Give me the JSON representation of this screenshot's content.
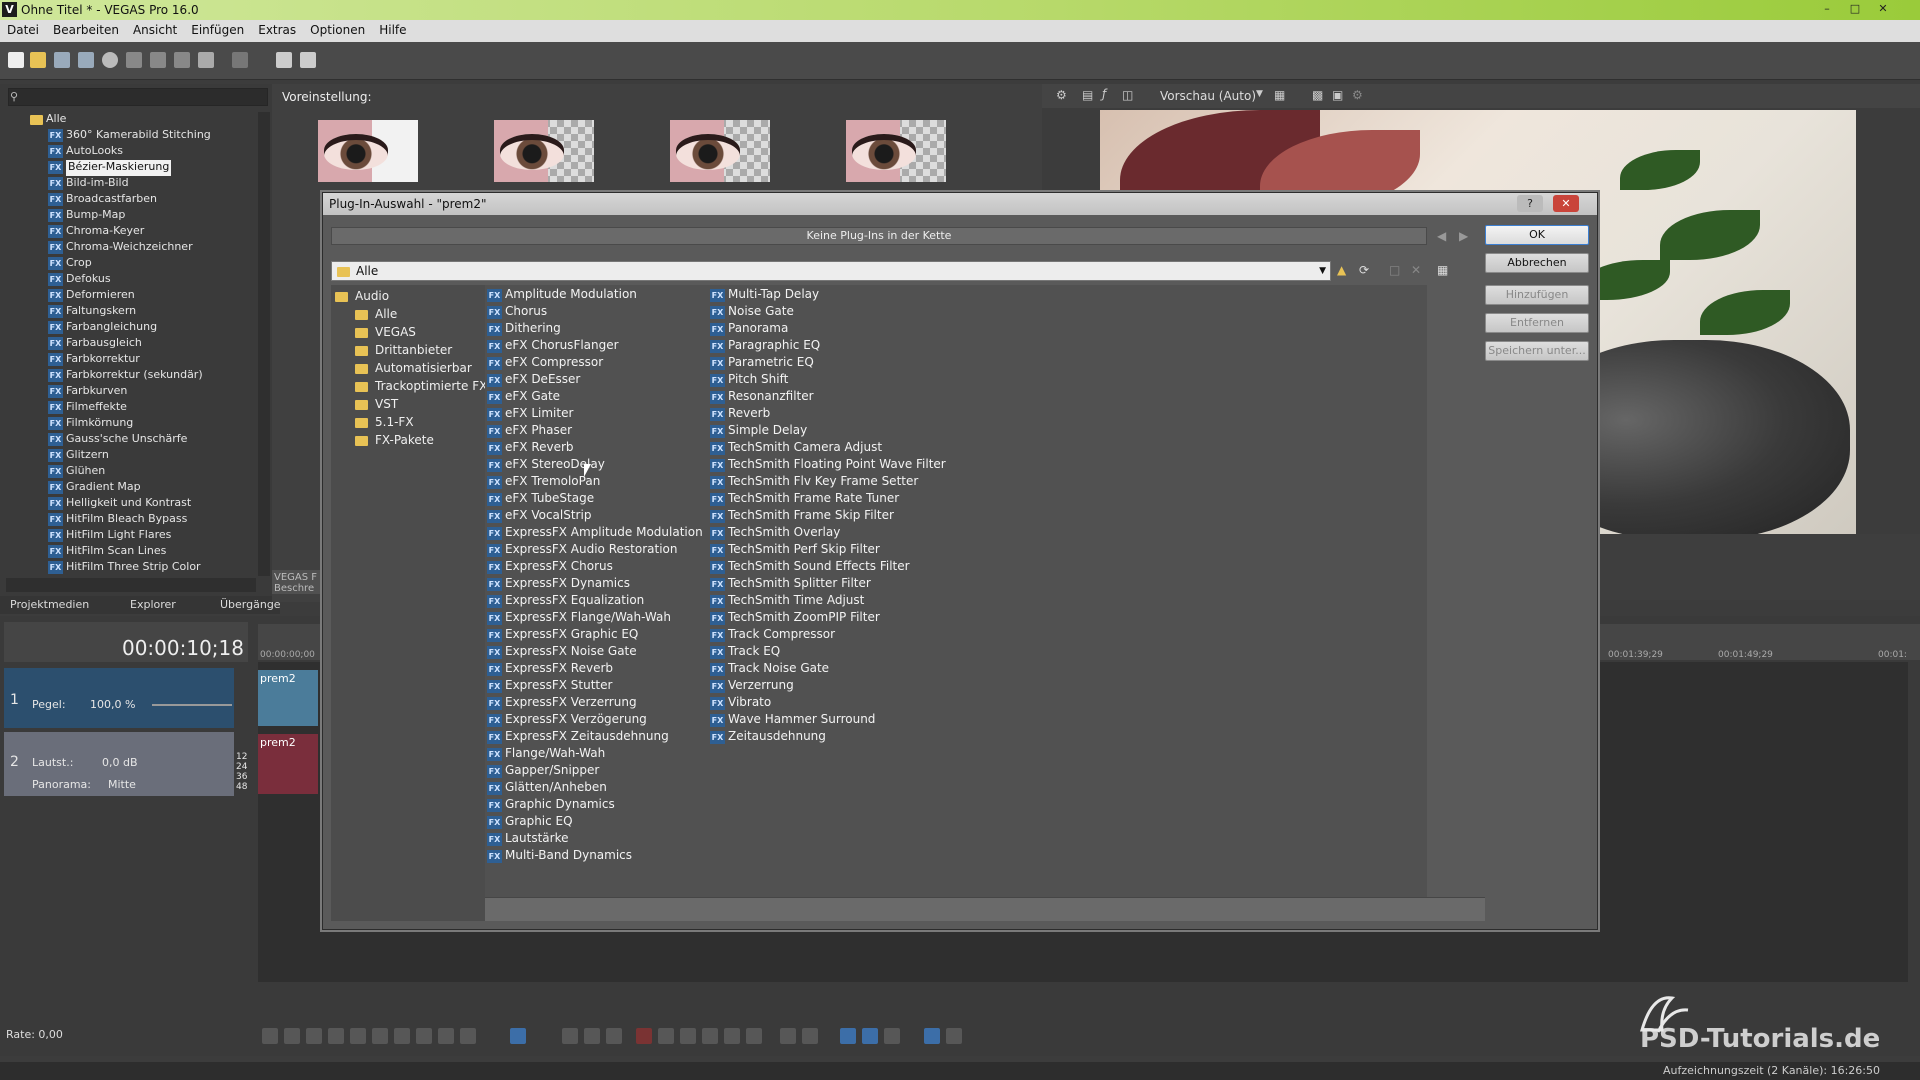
{
  "app": {
    "title": "Ohne Titel * - VEGAS Pro 16.0",
    "logo": "V"
  },
  "menu": [
    "Datei",
    "Bearbeiten",
    "Ansicht",
    "Einfügen",
    "Extras",
    "Optionen",
    "Hilfe"
  ],
  "fx_panel": {
    "items": [
      "Alle",
      "360° Kamerabild Stitching",
      "AutoLooks",
      "Bézier-Maskierung",
      "Bild-im-Bild",
      "Broadcastfarben",
      "Bump-Map",
      "Chroma-Keyer",
      "Chroma-Weichzeichner",
      "Crop",
      "Defokus",
      "Deformieren",
      "Faltungskern",
      "Farbangleichung",
      "Farbausgleich",
      "Farbkorrektur",
      "Farbkorrektur (sekundär)",
      "Farbkurven",
      "Filmeffekte",
      "Filmkörnung",
      "Gauss'sche Unschärfe",
      "Glitzern",
      "Glühen",
      "Gradient Map",
      "Helligkeit und Kontrast",
      "HitFilm Bleach Bypass",
      "HitFilm Light Flares",
      "HitFilm Scan Lines",
      "HitFilm Three Strip Color"
    ],
    "selected_index": 3,
    "fx_badge": "FX"
  },
  "bottom_tabs": [
    "Projektmedien",
    "Explorer",
    "Übergänge"
  ],
  "preset": {
    "label": "Voreinstellung:",
    "badge": [
      "VEGAS F",
      "Beschre"
    ]
  },
  "preview": {
    "mode_label": "Vorschau (Auto)"
  },
  "timeline": {
    "timecode": "00:00:10;18",
    "track1": {
      "pegel_label": "Pegel:",
      "pegel_value": "100,0 %",
      "clip": "prem2",
      "number": "1"
    },
    "track2": {
      "lautst_label": "Lautst.:",
      "lautst_value": "0,0 dB",
      "panorama_label": "Panorama:",
      "panorama_value": "Mitte",
      "clip": "prem2",
      "number": "2",
      "meter": [
        "12",
        "24",
        "36",
        "48"
      ]
    },
    "ruler": [
      "00:00:00;00",
      "00:01:39;29",
      "00:01:49;29",
      "00:01:"
    ],
    "rate": "Rate: 0,00"
  },
  "dialog": {
    "title": "Plug-In-Auswahl - \"prem2\"",
    "chain_text": "Keine Plug-Ins in der Kette",
    "path": "Alle",
    "tree": [
      {
        "label": "Audio",
        "level": 0
      },
      {
        "label": "Alle",
        "level": 1
      },
      {
        "label": "VEGAS",
        "level": 1
      },
      {
        "label": "Drittanbieter",
        "level": 1
      },
      {
        "label": "Automatisierbar",
        "level": 1
      },
      {
        "label": "Trackoptimierte FX",
        "level": 1
      },
      {
        "label": "VST",
        "level": 1
      },
      {
        "label": "5.1-FX",
        "level": 1
      },
      {
        "label": "FX-Pakete",
        "level": 1
      }
    ],
    "plugins_col1": [
      "Amplitude Modulation",
      "Chorus",
      "Dithering",
      "eFX ChorusFlanger",
      "eFX Compressor",
      "eFX DeEsser",
      "eFX Gate",
      "eFX Limiter",
      "eFX Phaser",
      "eFX Reverb",
      "eFX StereoDelay",
      "eFX TremoloPan",
      "eFX TubeStage",
      "eFX VocalStrip",
      "ExpressFX Amplitude Modulation",
      "ExpressFX Audio Restoration",
      "ExpressFX Chorus",
      "ExpressFX Dynamics",
      "ExpressFX Equalization",
      "ExpressFX Flange/Wah-Wah",
      "ExpressFX Graphic EQ",
      "ExpressFX Noise Gate",
      "ExpressFX Reverb",
      "ExpressFX Stutter",
      "ExpressFX Verzerrung",
      "ExpressFX Verzögerung",
      "ExpressFX Zeitausdehnung",
      "Flange/Wah-Wah",
      "Gapper/Snipper",
      "Glätten/Anheben",
      "Graphic Dynamics",
      "Graphic EQ",
      "Lautstärke",
      "Multi-Band Dynamics"
    ],
    "plugins_col2": [
      "Multi-Tap Delay",
      "Noise Gate",
      "Panorama",
      "Paragraphic EQ",
      "Parametric EQ",
      "Pitch Shift",
      "Resonanzfilter",
      "Reverb",
      "Simple Delay",
      "TechSmith Camera Adjust",
      "TechSmith Floating Point Wave Filter",
      "TechSmith Flv Key Frame Setter",
      "TechSmith Frame Rate Tuner",
      "TechSmith Frame Skip Filter",
      "TechSmith Overlay",
      "TechSmith Perf Skip Filter",
      "TechSmith Sound Effects Filter",
      "TechSmith Splitter Filter",
      "TechSmith Time Adjust",
      "TechSmith ZoomPIP Filter",
      "Track Compressor",
      "Track EQ",
      "Track Noise Gate",
      "Verzerrung",
      "Vibrato",
      "Wave Hammer Surround",
      "Zeitausdehnung"
    ],
    "buttons": {
      "ok": "OK",
      "cancel": "Abbrechen",
      "add": "Hinzufügen",
      "remove": "Entfernen",
      "save": "Speichern unter..."
    },
    "help": "?",
    "close": "✕"
  },
  "status": {
    "text": "Aufzeichnungszeit (2 Kanäle): 16:26:50"
  },
  "watermark": "PSD-Tutorials.de",
  "colors": {
    "accent": "#3c7fd2",
    "fx_badge": "#2e5f93",
    "folder": "#e8c255"
  }
}
